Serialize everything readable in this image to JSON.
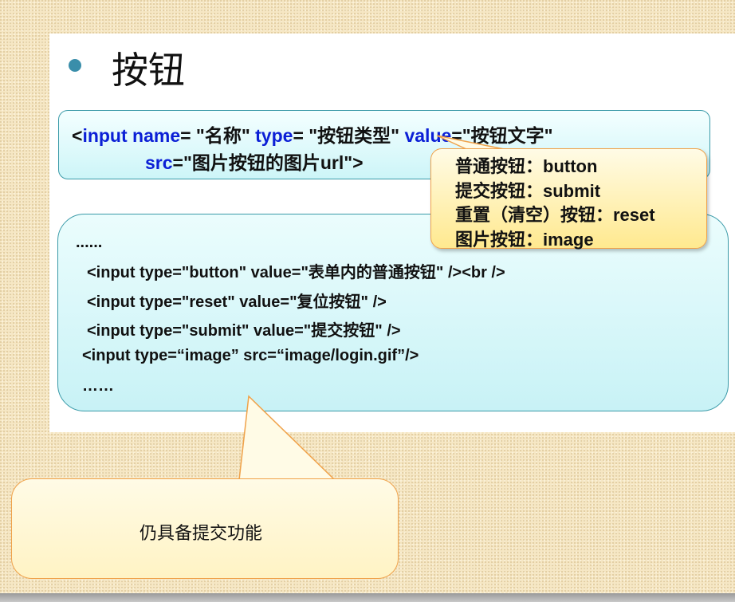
{
  "title": "按钮",
  "syntax": {
    "line1": [
      {
        "t": "<",
        "kw": false
      },
      {
        "t": "input name",
        "kw": true
      },
      {
        "t": "= \"名称\" ",
        "kw": false
      },
      {
        "t": "type",
        "kw": true
      },
      {
        "t": "= \"按钮类型\" ",
        "kw": false
      },
      {
        "t": "value",
        "kw": true
      },
      {
        "t": "=\"按钮文字\"",
        "kw": false
      }
    ],
    "line2": [
      {
        "t": "src",
        "kw": true
      },
      {
        "t": "=\"图片按钮的图片url\">",
        "kw": false
      }
    ]
  },
  "tooltip": {
    "items": [
      "普通按钮：button",
      "提交按钮：submit",
      "重置（清空）按钮：reset",
      "图片按钮：image"
    ]
  },
  "example": {
    "lines": [
      "......",
      "<input type=\"button\" value=\"表单内的普通按钮\" /><br />",
      "<input type=\"reset\" value=\"复位按钮\" />",
      "<input type=\"submit\" value=\"提交按钮\" />",
      "<input type=“image” src=“image/login.gif”/>",
      "……"
    ]
  },
  "callout": {
    "text": "仍具备提交功能"
  },
  "colors": {
    "keyword": "#0b1fd6",
    "accent": "#3a8eaa",
    "callout_border": "#f0a24a"
  }
}
